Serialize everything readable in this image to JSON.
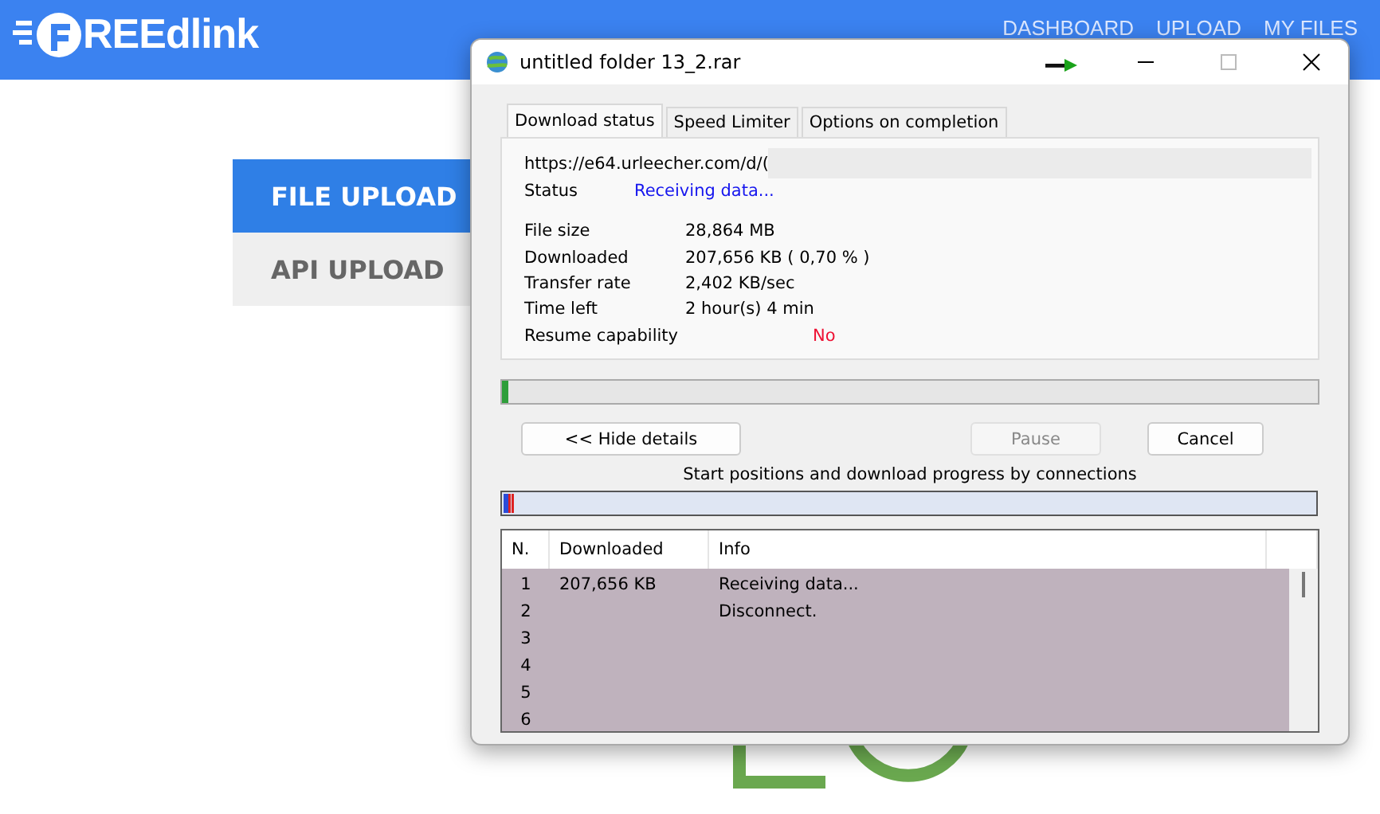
{
  "site": {
    "logo_text": "REEdlink",
    "nav": [
      {
        "label": "DASHBOARD"
      },
      {
        "label": "UPLOAD"
      },
      {
        "label": "MY FILES"
      }
    ],
    "upload_tabs": [
      {
        "label": "FILE UPLOAD",
        "selected": true
      },
      {
        "label": "API UPLOAD",
        "selected": false
      }
    ]
  },
  "dialog": {
    "title": "untitled folder 13_2.rar",
    "tabs": [
      {
        "label": "Download status",
        "selected": true
      },
      {
        "label": "Speed Limiter",
        "selected": false
      },
      {
        "label": "Options on completion",
        "selected": false
      }
    ],
    "url": "https://e64.urleecher.com/d/(",
    "status": {
      "label": "Status",
      "value": "Receiving data..."
    },
    "details": [
      {
        "label": "File size",
        "value": "28,864  MB",
        "kind": "normal"
      },
      {
        "label": "Downloaded",
        "value": "207,656  KB  ( 0,70 % )",
        "kind": "normal"
      },
      {
        "label": "Transfer rate",
        "value": "2,402  KB/sec",
        "kind": "normal"
      },
      {
        "label": "Time left",
        "value": "2 hour(s) 4 min",
        "kind": "normal"
      },
      {
        "label": "Resume capability",
        "value": "No",
        "kind": "warning"
      }
    ],
    "progress": {
      "level": 0.007
    },
    "buttons": [
      {
        "label": "<< Hide details",
        "disabled": false
      },
      {
        "label": "Pause",
        "disabled": true
      },
      {
        "label": "Cancel",
        "disabled": false
      }
    ],
    "connections_label": "Start positions and download progress by connections",
    "table": {
      "columns": [
        "N.",
        "Downloaded",
        "Info"
      ],
      "rows": [
        {
          "n": "1",
          "downloaded": "207,656  KB",
          "info": "Receiving data..."
        },
        {
          "n": "2",
          "info": "Disconnect."
        },
        {
          "n": "3"
        },
        {
          "n": "4"
        },
        {
          "n": "5"
        },
        {
          "n": "6"
        }
      ]
    }
  }
}
